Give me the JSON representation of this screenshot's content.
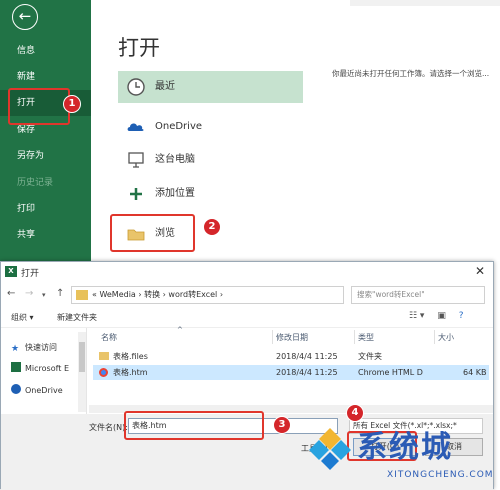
{
  "backstage": {
    "sidebar_items": [
      {
        "label": "信息"
      },
      {
        "label": "新建"
      },
      {
        "label": "打开"
      },
      {
        "label": "保存"
      },
      {
        "label": "另存为"
      },
      {
        "label": "历史记录"
      },
      {
        "label": "打印"
      },
      {
        "label": "共享"
      }
    ],
    "page_title": "打开",
    "locations": [
      {
        "label": "最近",
        "icon": "clock-icon"
      },
      {
        "label": "OneDrive",
        "icon": "cloud-icon"
      },
      {
        "label": "这台电脑",
        "icon": "computer-icon"
      },
      {
        "label": "添加位置",
        "icon": "plus-icon"
      },
      {
        "label": "浏览",
        "icon": "folder-icon"
      }
    ],
    "recent_message": "你最近尚未打开任何工作簿。请选择一个浏览..."
  },
  "annotations": [
    "1",
    "2",
    "3",
    "4"
  ],
  "dialog": {
    "title": "打开",
    "breadcrumb": [
      "WeMedia",
      "转换",
      "word转Excel"
    ],
    "search_placeholder": "搜索\"word转Excel\"",
    "toolbar": {
      "organize": "组织 ▾",
      "new_folder": "新建文件夹"
    },
    "nav_items": [
      {
        "label": "快速访问"
      },
      {
        "label": "Microsoft E"
      },
      {
        "label": "OneDrive"
      }
    ],
    "columns": [
      "名称",
      "修改日期",
      "类型",
      "大小"
    ],
    "files": [
      {
        "name": "表格.files",
        "date": "2018/4/4 11:25",
        "type": "文件夹",
        "size": ""
      },
      {
        "name": "表格.htm",
        "date": "2018/4/4 11:25",
        "type": "Chrome HTML D",
        "size": "64 KB"
      }
    ],
    "filename_label": "文件名(N):",
    "filename_value": "表格.htm",
    "filter": "所有 Excel 文件(*.xl*;*.xlsx;*",
    "tools": "工具(L)",
    "open": "打开(O)",
    "cancel": "取消"
  },
  "watermark": {
    "big": "系统城",
    "small": "XITONGCHENG.COM"
  },
  "colors": {
    "excel_green": "#217346",
    "selected_green": "#c6e2cf",
    "annotation_red": "#e0362c",
    "watermark_blue": "#2b5bb5"
  }
}
